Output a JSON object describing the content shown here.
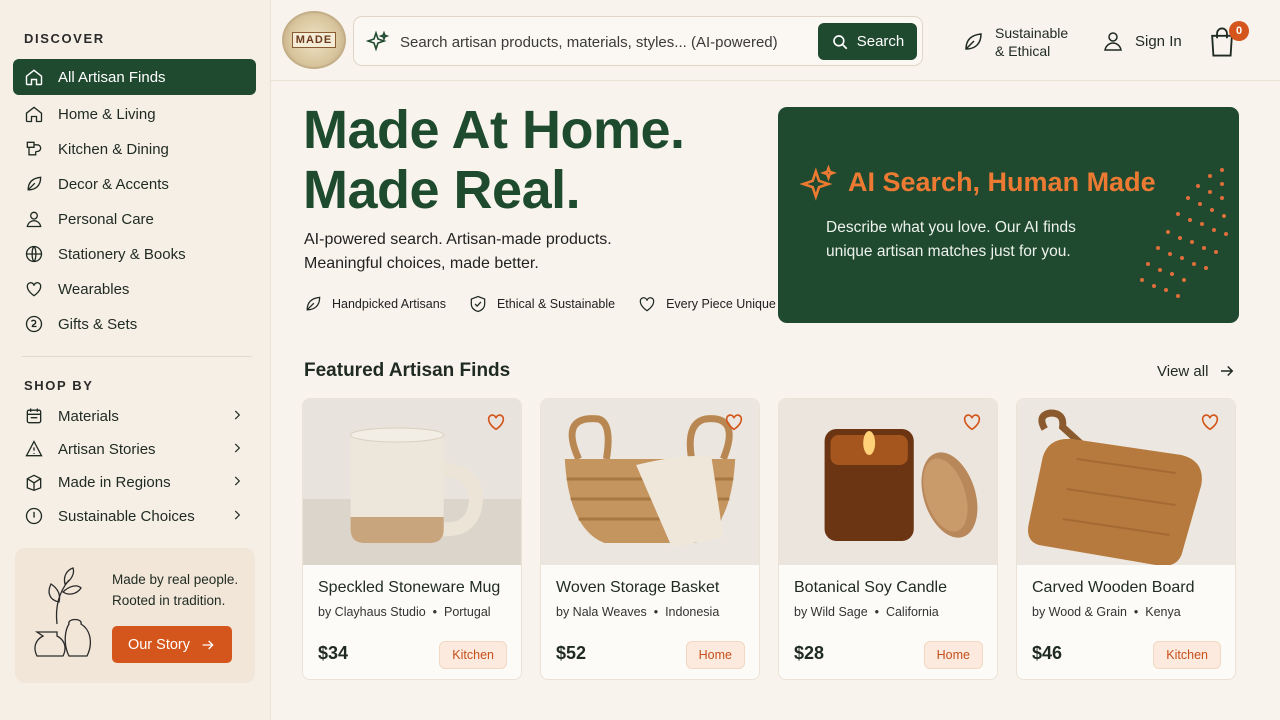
{
  "brand": {
    "logo_text": "MADE"
  },
  "sidebar": {
    "discover_heading": "DISCOVER",
    "discover_items": [
      {
        "label": "All Artisan Finds",
        "icon": "home-icon"
      },
      {
        "label": "Home & Living",
        "icon": "house-icon"
      },
      {
        "label": "Kitchen & Dining",
        "icon": "kitchen-icon"
      },
      {
        "label": "Decor & Accents",
        "icon": "leaf-icon"
      },
      {
        "label": "Personal Care",
        "icon": "person-icon"
      },
      {
        "label": "Stationery & Books",
        "icon": "globe-icon"
      },
      {
        "label": "Wearables",
        "icon": "heart-icon"
      },
      {
        "label": "Gifts & Sets",
        "icon": "gift-icon"
      }
    ],
    "shop_by_heading": "SHOP BY",
    "shop_by_items": [
      {
        "label": "Materials",
        "icon": "materials-icon"
      },
      {
        "label": "Artisan Stories",
        "icon": "warning-icon"
      },
      {
        "label": "Made in Regions",
        "icon": "map-icon"
      },
      {
        "label": "Sustainable Choices",
        "icon": "clock-icon"
      }
    ],
    "story": {
      "line1": "Made by real people.",
      "line2": "Rooted in tradition.",
      "button": "Our Story"
    }
  },
  "header": {
    "search_placeholder": "Search artisan products, materials, styles... (AI-powered)",
    "search_button": "Search",
    "sustainable_line1": "Sustainable",
    "sustainable_line2": "& Ethical",
    "sign_in": "Sign In",
    "cart_count": "0"
  },
  "hero": {
    "title_line1": "Made At Home.",
    "title_line2": "Made Real.",
    "subtitle_line1": "AI-powered search. Artisan-made products.",
    "subtitle_line2": "Meaningful choices, made better.",
    "badges": [
      "Handpicked Artisans",
      "Ethical & Sustainable",
      "Every Piece Unique"
    ]
  },
  "ai_card": {
    "title": "AI Search, Human Made",
    "desc_line1": "Describe what you love. Our AI finds",
    "desc_line2": "unique artisan matches just for you."
  },
  "featured": {
    "title": "Featured Artisan Finds",
    "view_all": "View all",
    "products": [
      {
        "name": "Speckled Stoneware Mug",
        "maker": "by Clayhaus Studio",
        "region": "Portugal",
        "price": "$34",
        "category": "Kitchen"
      },
      {
        "name": "Woven Storage Basket",
        "maker": "by Nala Weaves",
        "region": "Indonesia",
        "price": "$52",
        "category": "Home"
      },
      {
        "name": "Botanical Soy Candle",
        "maker": "by Wild Sage",
        "region": "California",
        "price": "$28",
        "category": "Home"
      },
      {
        "name": "Carved Wooden Board",
        "maker": "by Wood & Grain",
        "region": "Kenya",
        "price": "$46",
        "category": "Kitchen"
      }
    ]
  },
  "colors": {
    "primary_green": "#1f4a2f",
    "accent_orange": "#d4561c",
    "background": "#f8f3ec"
  }
}
